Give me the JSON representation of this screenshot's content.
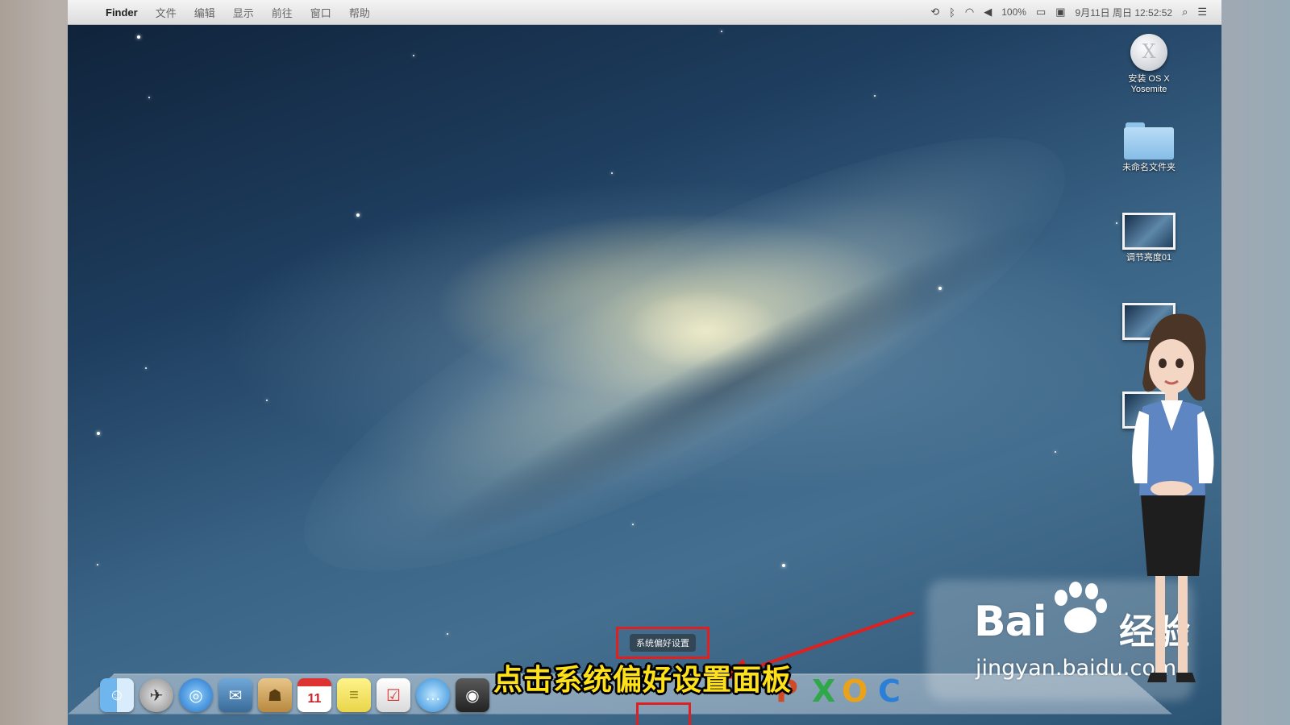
{
  "menubar": {
    "apple_icon": "apple-icon",
    "items": [
      "Finder",
      "文件",
      "编辑",
      "显示",
      "前往",
      "窗口",
      "帮助"
    ],
    "status": {
      "battery": "100%",
      "datetime": "9月11日 周日 12:52:52"
    }
  },
  "desktop": {
    "icons": [
      {
        "label": "安装 OS X Yosemite"
      },
      {
        "label": "未命名文件夹"
      },
      {
        "label": "调节亮度01"
      }
    ]
  },
  "dock": {
    "tooltip": "系统偏好设置",
    "calendar_day": "11"
  },
  "subtitle": "点击系统偏好设置面板",
  "watermark": {
    "brand": "Bai",
    "brand_cn": "经验",
    "url": "jingyan.baidu.com"
  },
  "colors": {
    "highlight": "#e02020",
    "subtitle": "#ffe11a"
  }
}
